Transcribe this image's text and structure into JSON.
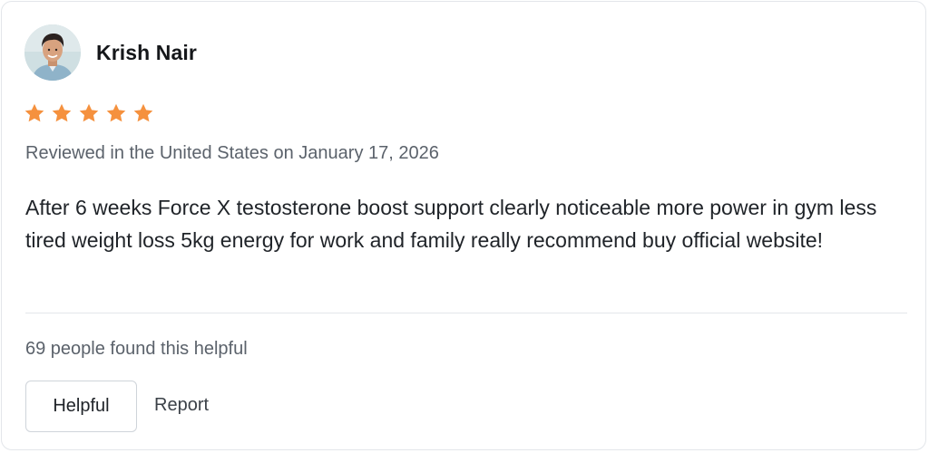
{
  "review": {
    "author": "Krish Nair",
    "avatar_icon": "person-avatar",
    "rating": 5,
    "max_rating": 5,
    "star_color": "#f5913e",
    "meta": "Reviewed in the United States on January 17, 2026",
    "text": "After 6 weeks Force X testosterone boost support clearly noticeable more power in gym less tired weight loss 5kg energy for work and family really recommend buy official website!",
    "helpful_count_text": "69 people found this helpful",
    "helpful_button_label": "Helpful",
    "report_label": "Report"
  }
}
